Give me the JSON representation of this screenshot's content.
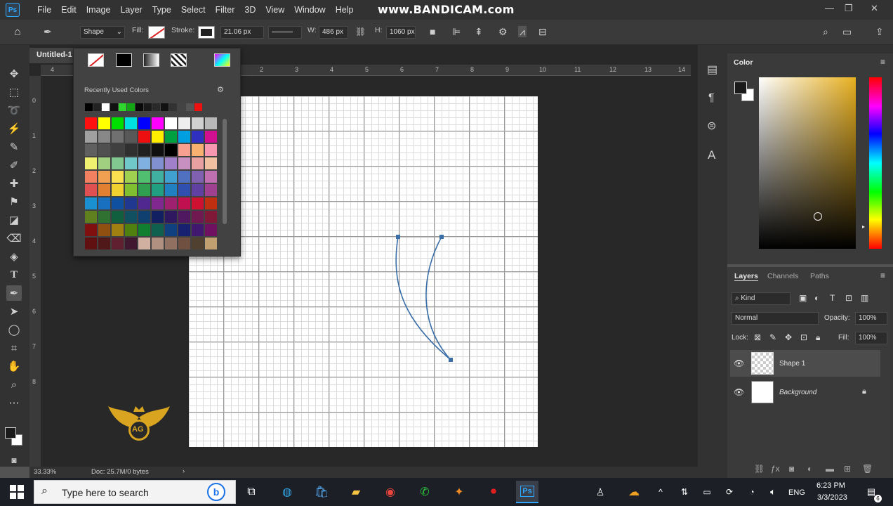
{
  "menubar": {
    "app_icon": "Ps",
    "items": [
      "File",
      "Edit",
      "Image",
      "Layer",
      "Type",
      "Select",
      "Filter",
      "3D",
      "View",
      "Window",
      "Help"
    ],
    "watermark": "www.BANDICAM.com"
  },
  "options": {
    "mode": "Shape",
    "fill_label": "Fill:",
    "stroke_label": "Stroke:",
    "stroke_width": "21.06 px",
    "w_label": "W:",
    "w_value": "486 px",
    "h_label": "H:",
    "h_value": "1060 px"
  },
  "document": {
    "tab_title": "Untitled-1",
    "ruler_h": [
      "4",
      "2",
      "3",
      "4",
      "5",
      "6",
      "7",
      "8",
      "9",
      "10",
      "11",
      "12",
      "13",
      "14"
    ],
    "ruler_v": [
      "0",
      "1",
      "2",
      "3",
      "4",
      "5",
      "6",
      "7",
      "8"
    ],
    "zoom": "33.33%",
    "doc_info": "Doc: 25.7M/0 bytes"
  },
  "swatches_popup": {
    "title": "Recently Used Colors",
    "recent": [
      "#000000",
      "#222222",
      "#ffffff",
      "#111111",
      "#2ed62e",
      "#14a514",
      "#0a0a0a",
      "#1a1a1a",
      "#2a2a2a",
      "#111",
      "#333",
      "#444",
      "#555",
      "#ee1111"
    ],
    "colors": [
      "#ff1010",
      "#ffff00",
      "#00e000",
      "#00e0e0",
      "#0000ff",
      "#ff00ff",
      "#ffffff",
      "#eeeeee",
      "#d0d0d0",
      "#b8b8b8",
      "#a0a0a0",
      "#888888",
      "#707070",
      "#585858",
      "#ee1010",
      "#ffee00",
      "#00a040",
      "#00a0e0",
      "#3030c0",
      "#d01090",
      "#606060",
      "#505050",
      "#404040",
      "#303030",
      "#202020",
      "#101010",
      "#000000",
      "#f8a090",
      "#f8b070",
      "#f898b0",
      "#f0f070",
      "#a0d080",
      "#80c890",
      "#70c8c8",
      "#80b0e0",
      "#8090d0",
      "#a080c8",
      "#c890c0",
      "#e8a0a0",
      "#f0c0a0",
      "#f08060",
      "#f0a050",
      "#f8e050",
      "#a0d050",
      "#50c070",
      "#40b0a0",
      "#40a0d0",
      "#5070c0",
      "#8060b0",
      "#c070b0",
      "#e05050",
      "#e08030",
      "#f0d030",
      "#80c030",
      "#30a050",
      "#20a080",
      "#2080c0",
      "#3050b0",
      "#6040a0",
      "#a04090",
      "#1a90d0",
      "#1a70c0",
      "#1050a0",
      "#203890",
      "#502890",
      "#802890",
      "#a02070",
      "#c01050",
      "#d01030",
      "#c03010",
      "#608020",
      "#307030",
      "#106040",
      "#105060",
      "#104070",
      "#102060",
      "#301860",
      "#501860",
      "#701850",
      "#801838",
      "#801010",
      "#905010",
      "#a08010",
      "#508010",
      "#108030",
      "#106050",
      "#104080",
      "#182070",
      "#401870",
      "#701060",
      "#601010",
      "#501818",
      "#602030",
      "#401830",
      "#d0b0a0",
      "#b09080",
      "#907060",
      "#705040",
      "#504030",
      "#c0a070"
    ]
  },
  "right_strip_icons": [
    "properties-icon",
    "paragraph-icon",
    "adjustments-icon",
    "character-icon"
  ],
  "color_panel": {
    "title": "Color",
    "fg": "#1a1a1a",
    "bg": "#ffffff",
    "hue_accent": "#e8b020"
  },
  "layers_panel": {
    "tabs": [
      "Layers",
      "Channels",
      "Paths"
    ],
    "filter": "Kind",
    "blend_mode": "Normal",
    "opacity_label": "Opacity:",
    "opacity": "100%",
    "lock_label": "Lock:",
    "fill_label": "Fill:",
    "fill": "100%",
    "layers": [
      {
        "name": "Shape 1",
        "selected": true
      },
      {
        "name": "Background",
        "selected": false
      }
    ]
  },
  "taskbar": {
    "search_placeholder": "Type here to search",
    "language": "ENG",
    "time": "6:23 PM",
    "date": "3/3/2023",
    "notifications": "6"
  },
  "logo_text": "AG"
}
